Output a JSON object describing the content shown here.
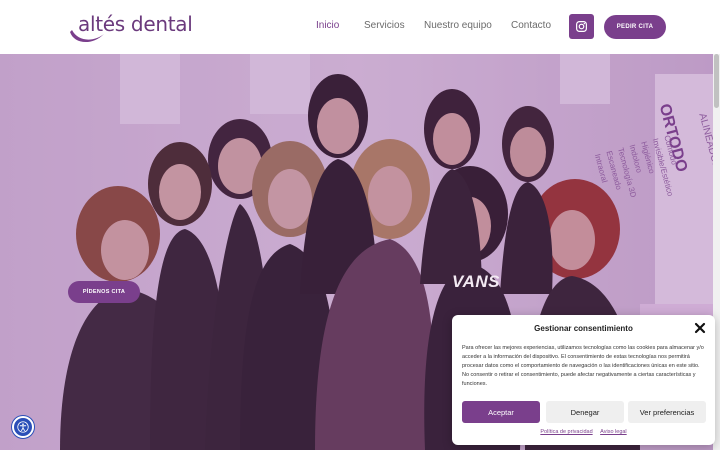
{
  "brand": {
    "logo_text": "altés dental",
    "accent_color": "#7a3f8c"
  },
  "nav": {
    "items": [
      {
        "label": "Inicio",
        "active": true
      },
      {
        "label": "Servicios",
        "active": false
      },
      {
        "label": "Nuestro equipo",
        "active": false
      },
      {
        "label": "Contacto",
        "active": false
      }
    ],
    "instagram_icon": "instagram-icon",
    "cta_label": "PEDIR CITA"
  },
  "hero": {
    "cta_label": "PÍDENOS CITA",
    "poster": {
      "title_partial": "ORTODO",
      "subtitle_partial": "ALINEADOR",
      "features": [
        "Cómodo",
        "Invisible/Estético",
        "Higiénico",
        "Indoloro",
        "Tecnología 3D",
        "Escaneado",
        "Intraoral"
      ]
    },
    "shirt_text": "VANS"
  },
  "accessibility": {
    "icon": "accessibility-icon"
  },
  "cookie_modal": {
    "title": "Gestionar consentimiento",
    "body": "Para ofrecer las mejores experiencias, utilizamos tecnologías como las cookies para almacenar y/o acceder a la información del dispositivo. El consentimiento de estas tecnologías nos permitirá procesar datos como el comportamiento de navegación o las identificaciones únicas en este sitio. No consentir o retirar el consentimiento, puede afectar negativamente a ciertas características y funciones.",
    "accept_label": "Aceptar",
    "deny_label": "Denegar",
    "prefs_label": "Ver preferencias",
    "privacy_link": "Política de privacidad",
    "legal_link": "Aviso legal"
  }
}
